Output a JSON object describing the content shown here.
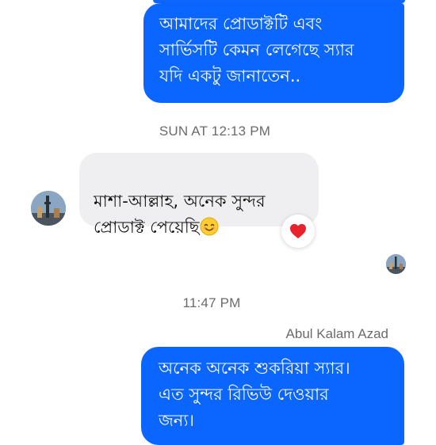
{
  "thread": {
    "messages": [
      {
        "direction": "outgoing",
        "text": "আমাদের প্রোডাক্টটি এবং\nসার্ভিসটি কেমন লেগেছে স্যার\nযদি একটু জানাতেন.."
      },
      {
        "direction": "incoming",
        "text": "মাশা-আল্লাহ, অনেক সুন্দর\nপ্রোডাক্ট পেয়েছি",
        "emoji": "smiling-face-icon",
        "reaction": "heart-icon"
      },
      {
        "direction": "outgoing",
        "sender": "Abul Kalam Azad",
        "text": "অনেক অনেক শুকরিয়া স্যার।\nএত সুন্দর রিভিউ দেওয়ার\nজন্য।"
      }
    ],
    "timestamps": [
      "SUN AT 12:13 PM",
      "11:47 PM"
    ],
    "sender_name": "Abul Kalam Azad"
  },
  "colors": {
    "outgoing_bubble": "#0b66ff",
    "incoming_bubble": "#efeff1",
    "timestamp_text": "#6b6b6b",
    "reaction_heart": "#e8232e"
  }
}
